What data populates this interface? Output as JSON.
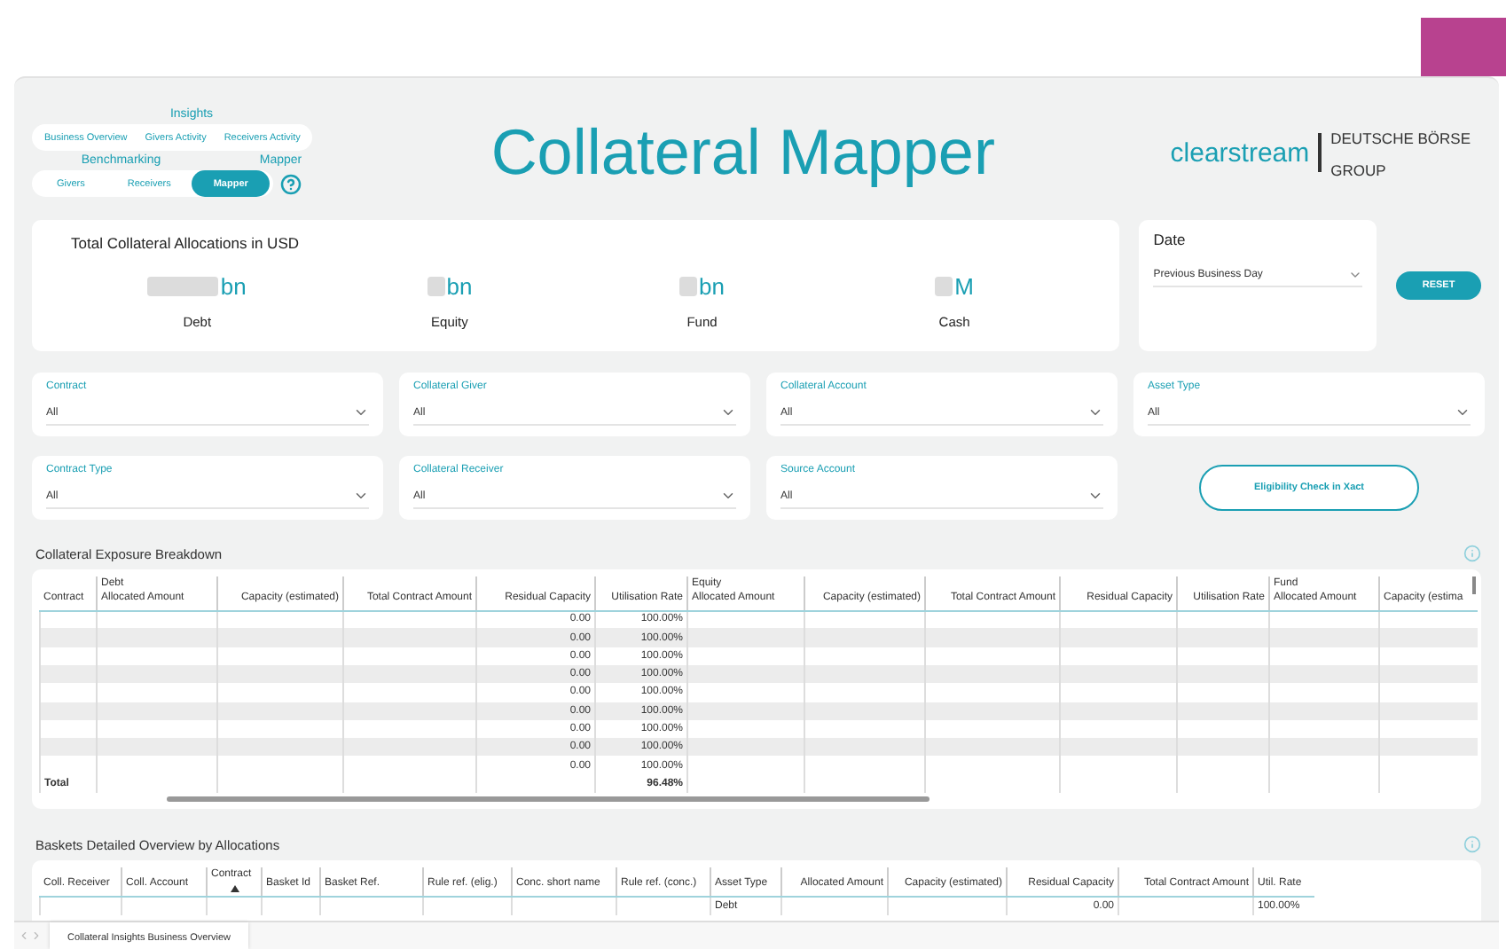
{
  "nav": {
    "group_label": "Insights",
    "insights_tabs": [
      {
        "label": "Business Overview",
        "selected": false
      },
      {
        "label": "Givers Activity",
        "selected": false
      },
      {
        "label": "Receivers Activity",
        "selected": false
      }
    ],
    "section_labels": [
      "Benchmarking",
      "Mapper"
    ],
    "sub_tabs": [
      {
        "label": "Givers",
        "selected": false
      },
      {
        "label": "Receivers",
        "selected": false
      },
      {
        "label": "Mapper",
        "selected": true
      }
    ]
  },
  "title": "Collateral Mapper",
  "logo": {
    "brand": "clearstream",
    "group_lines": [
      "DEUTSCHE BÖRSE",
      "GROUP"
    ]
  },
  "kpi": {
    "title": "Total Collateral Allocations in USD",
    "items": [
      {
        "unit": "bn",
        "label": "Debt"
      },
      {
        "unit": "bn",
        "label": "Equity"
      },
      {
        "unit": "bn",
        "label": "Fund"
      },
      {
        "unit": "M",
        "label": "Cash"
      }
    ]
  },
  "date": {
    "label": "Date",
    "value": "Previous Business Day"
  },
  "reset_button": "RESET",
  "filters": [
    {
      "label": "Contract",
      "value": "All"
    },
    {
      "label": "Collateral Giver",
      "value": "All"
    },
    {
      "label": "Collateral Account",
      "value": "All"
    },
    {
      "label": "Asset Type",
      "value": "All"
    },
    {
      "label": "Contract Type",
      "value": "All"
    },
    {
      "label": "Collateral Receiver",
      "value": "All"
    },
    {
      "label": "Source Account",
      "value": "All"
    }
  ],
  "eligibility_button": "Eligibility Check in Xact",
  "exposure": {
    "title": "Collateral Exposure Breakdown",
    "columns": [
      {
        "label": "Contract"
      },
      {
        "group": "Debt",
        "label": "Allocated Amount"
      },
      {
        "label": "Capacity (estimated)"
      },
      {
        "label": "Total Contract Amount"
      },
      {
        "label": "Residual Capacity"
      },
      {
        "label": "Utilisation Rate"
      },
      {
        "group": "Equity",
        "label": "Allocated Amount"
      },
      {
        "label": "Capacity (estimated)"
      },
      {
        "label": "Total Contract Amount"
      },
      {
        "label": "Residual Capacity"
      },
      {
        "label": "Utilisation Rate"
      },
      {
        "group": "Fund",
        "label": "Allocated Amount"
      },
      {
        "label": "Capacity (estima"
      }
    ],
    "rows": [
      {
        "residual": "0.00",
        "utilisation": "100.00%"
      },
      {
        "residual": "0.00",
        "utilisation": "100.00%"
      },
      {
        "residual": "0.00",
        "utilisation": "100.00%"
      },
      {
        "residual": "0.00",
        "utilisation": "100.00%"
      },
      {
        "residual": "0.00",
        "utilisation": "100.00%"
      },
      {
        "residual": "0.00",
        "utilisation": "100.00%"
      },
      {
        "residual": "0.00",
        "utilisation": "100.00%"
      },
      {
        "residual": "0.00",
        "utilisation": "100.00%"
      },
      {
        "residual": "0.00",
        "utilisation": "100.00%"
      }
    ],
    "total": {
      "label": "Total",
      "utilisation": "96.48%"
    }
  },
  "baskets": {
    "title": "Baskets Detailed Overview by Allocations",
    "columns": [
      {
        "label": "Coll. Receiver",
        "sorted": false
      },
      {
        "label": "Coll. Account",
        "sorted": false
      },
      {
        "label": "Contract",
        "sorted": true
      },
      {
        "label": "Basket Id",
        "sorted": false
      },
      {
        "label": "Basket Ref.",
        "sorted": false
      },
      {
        "label": "Rule ref. (elig.)",
        "sorted": false
      },
      {
        "label": "Conc. short name",
        "sorted": false
      },
      {
        "label": "Rule ref. (conc.)",
        "sorted": false
      },
      {
        "label": "Asset Type",
        "sorted": false
      },
      {
        "label": "Allocated Amount",
        "sorted": false
      },
      {
        "label": "Capacity (estimated)",
        "sorted": false
      },
      {
        "label": "Residual Capacity",
        "sorted": false
      },
      {
        "label": "Total Contract Amount",
        "sorted": false
      },
      {
        "label": "Util. Rate",
        "sorted": false
      }
    ],
    "rows": [
      {
        "asset_type": "Debt",
        "residual": "0.00",
        "utilisation": "100.00%"
      }
    ]
  },
  "page_tabs": [
    {
      "label": "Collateral Insights Business Overview",
      "selected": true
    }
  ]
}
